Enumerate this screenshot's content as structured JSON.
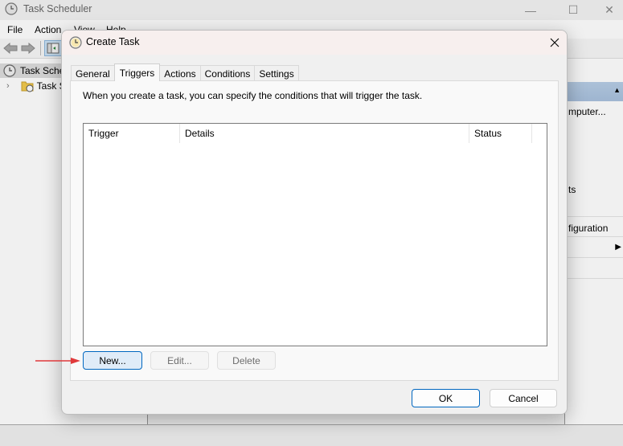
{
  "background_app": {
    "title": "Task Scheduler",
    "window_controls": {
      "minimize": "—",
      "maximize": "☐",
      "close": "✕"
    },
    "menu": [
      "File",
      "Action",
      "View",
      "Help"
    ],
    "tree": [
      {
        "label": "Task Sche",
        "icon": "clock-icon"
      },
      {
        "label": "Task S",
        "icon": "folder-clock-icon"
      }
    ],
    "actions_panel": {
      "items": [
        "mputer...",
        "ts",
        "figuration"
      ]
    }
  },
  "dialog": {
    "title": "Create Task",
    "close_glyph": "✕",
    "tabs": [
      {
        "label": "General",
        "active": false
      },
      {
        "label": "Triggers",
        "active": true
      },
      {
        "label": "Actions",
        "active": false
      },
      {
        "label": "Conditions",
        "active": false
      },
      {
        "label": "Settings",
        "active": false
      }
    ],
    "instruction": "When you create a task, you can specify the conditions that will trigger the task.",
    "triggers_table": {
      "columns": [
        "Trigger",
        "Details",
        "Status"
      ],
      "rows": []
    },
    "buttons": {
      "new": "New...",
      "edit": "Edit...",
      "delete": "Delete",
      "ok": "OK",
      "cancel": "Cancel"
    }
  },
  "annotation": {
    "arrow_color": "#e0393b",
    "points_to": "new-trigger-button"
  }
}
